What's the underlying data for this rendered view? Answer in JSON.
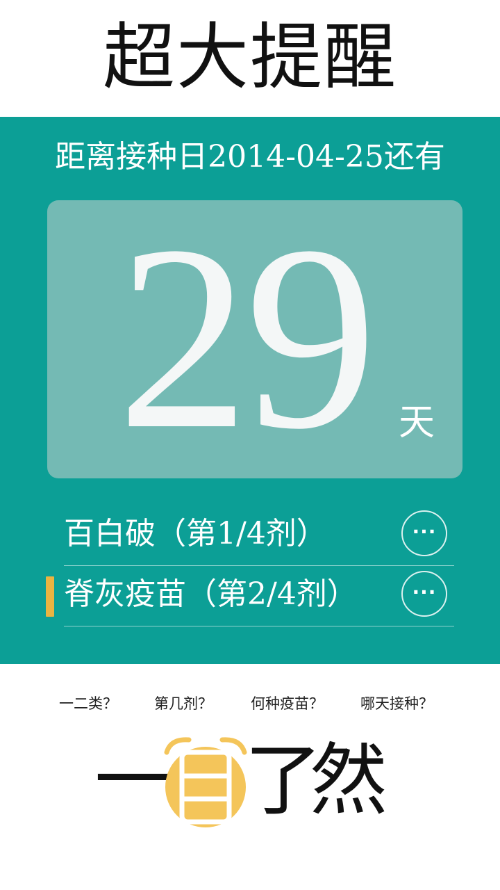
{
  "header": {
    "title": "超大提醒"
  },
  "countdown": {
    "date_line": "距离接种日2014-04-25还有",
    "days": "29",
    "unit": "天"
  },
  "vaccines": [
    {
      "label": "百白破（第1/4剂）",
      "more": "···",
      "selected": false
    },
    {
      "label": "脊灰疫苗（第2/4剂）",
      "more": "···",
      "selected": true
    }
  ],
  "questions": [
    "一二类？",
    "第几剂？",
    "何种疫苗？",
    "哪天接种？"
  ],
  "slogan": {
    "c1": "一",
    "icon": "calendar-eye-icon",
    "c3": "了",
    "c4": "然"
  },
  "colors": {
    "teal": "#0c9f96",
    "card": "#74bab4",
    "marker": "#e9b442",
    "icon_yellow": "#f4c55a"
  }
}
